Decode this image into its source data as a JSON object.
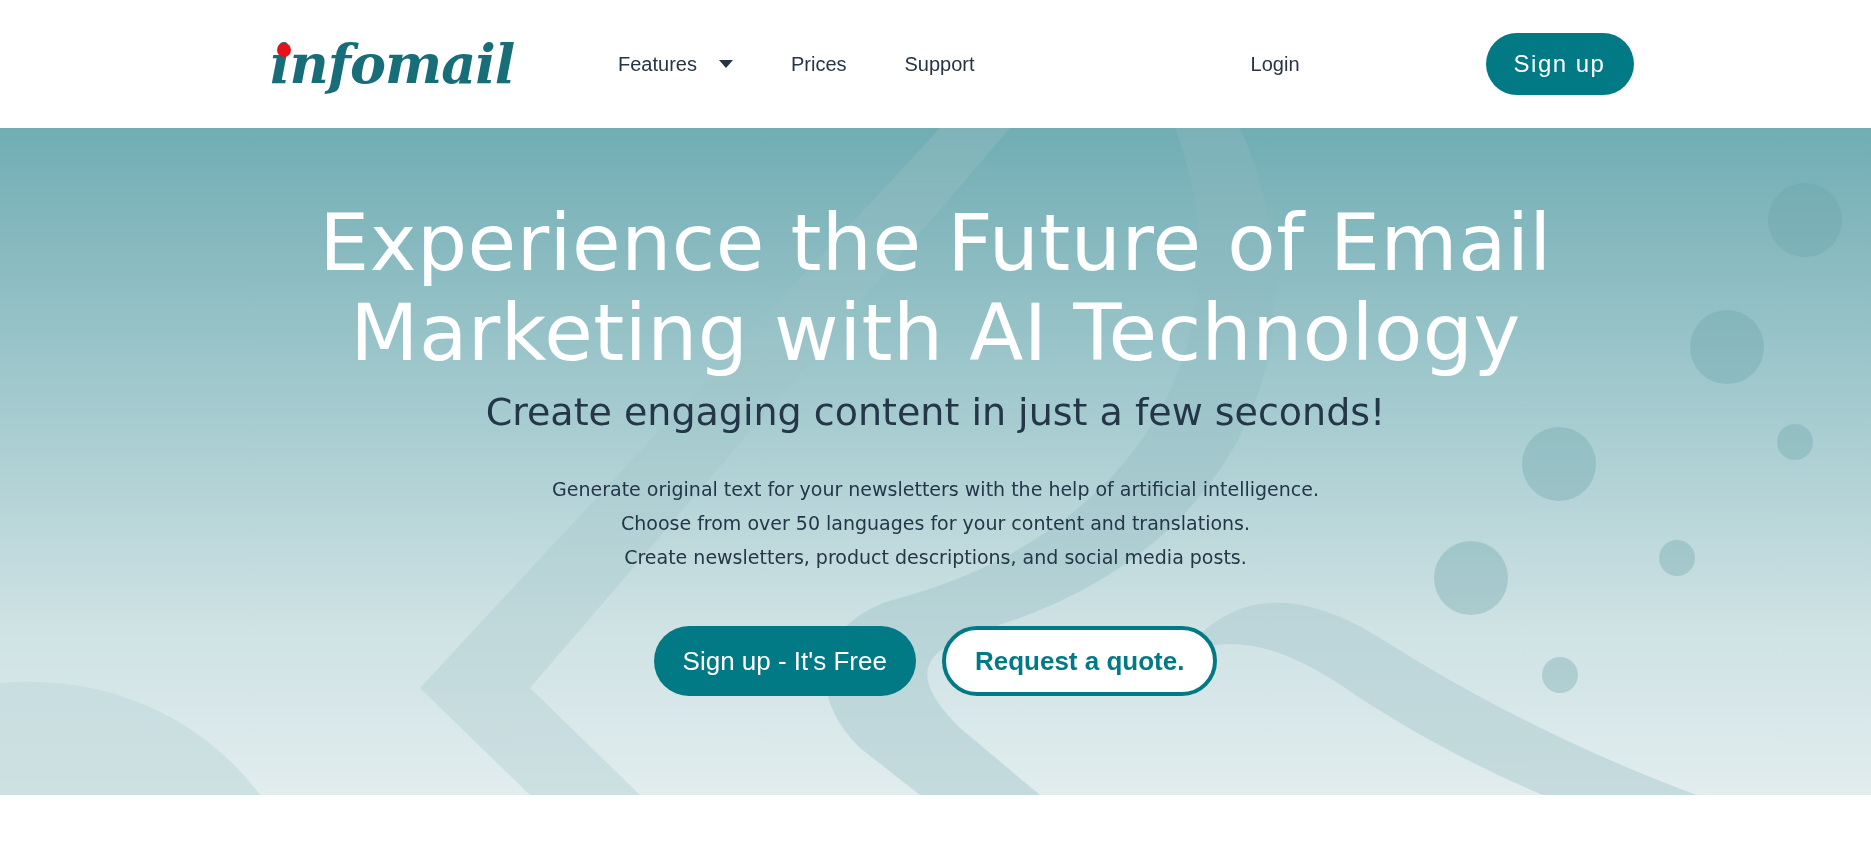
{
  "header": {
    "logo": "infomail",
    "nav": [
      {
        "label": "Features",
        "dropdown": true
      },
      {
        "label": "Prices",
        "dropdown": false
      },
      {
        "label": "Support",
        "dropdown": false
      }
    ],
    "login": "Login",
    "signup": "Sign up"
  },
  "hero": {
    "title_lines": [
      "Experience the Future of Email",
      "Marketing with AI Technology"
    ],
    "subtitle": "Create engaging content in just a few seconds!",
    "description": [
      "Generate original text for your newsletters with the help of artificial intelligence.",
      "Choose from over 50 languages for your content and translations.",
      "Create newsletters, product descriptions, and social media posts."
    ],
    "buttons": [
      {
        "label": "Sign up - It's Free",
        "kind": "primary"
      },
      {
        "label": "Request a quote.",
        "kind": "outline"
      }
    ]
  }
}
